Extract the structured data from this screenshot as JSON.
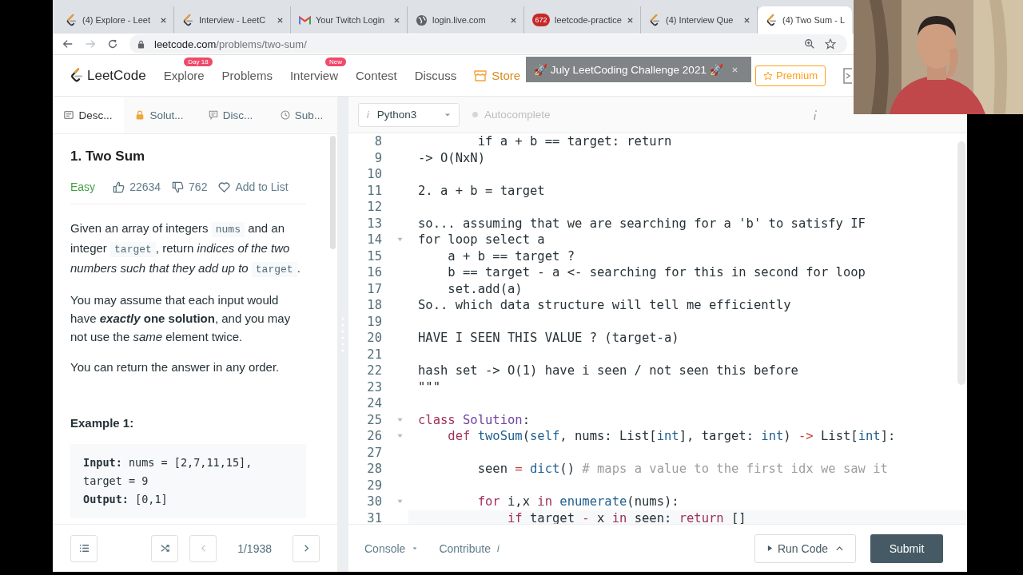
{
  "browser": {
    "tabs": [
      {
        "title": "(4) Explore - Leet",
        "kind": "leetcode",
        "selected": false
      },
      {
        "title": "Interview - LeetC",
        "kind": "leetcode",
        "selected": false
      },
      {
        "title": "Your Twitch Login",
        "kind": "mail",
        "selected": false
      },
      {
        "title": "login.live.com",
        "kind": "globe",
        "selected": false
      },
      {
        "title": "leetcode-practice",
        "kind": "badge",
        "badge": "672",
        "selected": false
      },
      {
        "title": "(4) Interview Que",
        "kind": "leetcode",
        "selected": false
      },
      {
        "title": "(4) Two Sum - L",
        "kind": "leetcode",
        "selected": true
      }
    ],
    "url_host": "leetcode.com",
    "url_path": "/problems/two-sum/"
  },
  "nav": {
    "logo": "LeetCode",
    "items": [
      {
        "label": "Explore",
        "badge": "Day 18",
        "kind": "link"
      },
      {
        "label": "Problems",
        "kind": "link"
      },
      {
        "label": "Interview",
        "badge": "New",
        "kind": "link"
      },
      {
        "label": "Contest",
        "kind": "link"
      },
      {
        "label": "Discuss",
        "kind": "link"
      },
      {
        "label": "Store",
        "kind": "store"
      }
    ],
    "toast": "🚀 July LeetCoding Challenge 2021 🚀",
    "premium": "Premium"
  },
  "problem": {
    "tabs": [
      {
        "label": "Desc...",
        "selected": true
      },
      {
        "label": "Solut...",
        "selected": false
      },
      {
        "label": "Disc...",
        "selected": false
      },
      {
        "label": "Sub...",
        "selected": false
      }
    ],
    "title": "1. Two Sum",
    "difficulty": "Easy",
    "likes": "22634",
    "dislikes": "762",
    "add_to_list": "Add to List",
    "paragraphs": [
      [
        {
          "text": "Given an array of integers ",
          "kind": "text"
        },
        {
          "text": "nums",
          "kind": "code"
        },
        {
          "text": " and an integer ",
          "kind": "text"
        },
        {
          "text": "target",
          "kind": "code"
        },
        {
          "text": ", return ",
          "kind": "text"
        },
        {
          "text": "indices of the two numbers such that they add up to ",
          "kind": "italic"
        },
        {
          "text": "target",
          "kind": "code"
        },
        {
          "text": ".",
          "kind": "text"
        }
      ],
      [
        {
          "text": "You may assume that each input would have ",
          "kind": "text"
        },
        {
          "text": "exactly",
          "kind": "bold-italic"
        },
        {
          "text": " one solution",
          "kind": "bold"
        },
        {
          "text": ", and you may not use the ",
          "kind": "text"
        },
        {
          "text": "same",
          "kind": "italic"
        },
        {
          "text": " element twice.",
          "kind": "text"
        }
      ],
      [
        {
          "text": "You can return the answer in any order.",
          "kind": "text"
        }
      ]
    ],
    "example_title": "Example 1:",
    "example_lines": [
      {
        "label": "Input:",
        "text": " nums = [2,7,11,15],"
      },
      {
        "text": "target = 9"
      },
      {
        "label": "Output:",
        "text": " [0,1]"
      }
    ],
    "pager": "1/1938"
  },
  "editor": {
    "language_info": "i",
    "language": "Python3",
    "autocomplete": {
      "label": "Autocomplete",
      "on": false
    },
    "lines": [
      {
        "no": "8",
        "foldable": false,
        "active": false,
        "tokens": [
          {
            "text": "        if a + b == target: return",
            "kind": "text"
          }
        ]
      },
      {
        "no": "9",
        "foldable": false,
        "active": false,
        "tokens": [
          {
            "text": "-> O(NxN)",
            "kind": "text"
          }
        ]
      },
      {
        "no": "10",
        "foldable": false,
        "active": false
      },
      {
        "no": "11",
        "foldable": false,
        "active": false,
        "tokens": [
          {
            "text": "2. a + b = target",
            "kind": "text"
          }
        ]
      },
      {
        "no": "12",
        "foldable": false,
        "active": false
      },
      {
        "no": "13",
        "foldable": false,
        "active": false,
        "tokens": [
          {
            "text": "so... assuming that we are searching for a 'b' to satisfy IF",
            "kind": "text"
          }
        ]
      },
      {
        "no": "14",
        "foldable": true,
        "active": false,
        "tokens": [
          {
            "text": "for loop select a",
            "kind": "text"
          }
        ]
      },
      {
        "no": "15",
        "foldable": false,
        "active": false,
        "tokens": [
          {
            "text": "    a + b == target ?",
            "kind": "text"
          }
        ]
      },
      {
        "no": "16",
        "foldable": false,
        "active": false,
        "tokens": [
          {
            "text": "    b == target - a <- searching for this in second for loop",
            "kind": "text"
          }
        ]
      },
      {
        "no": "17",
        "foldable": false,
        "active": false,
        "tokens": [
          {
            "text": "    set.add(a)",
            "kind": "text"
          }
        ]
      },
      {
        "no": "18",
        "foldable": false,
        "active": false,
        "tokens": [
          {
            "text": "So.. which data structure will tell me efficiently",
            "kind": "text"
          }
        ]
      },
      {
        "no": "19",
        "foldable": false,
        "active": false
      },
      {
        "no": "20",
        "foldable": false,
        "active": false,
        "tokens": [
          {
            "text": "HAVE I SEEN THIS VALUE ? (target-a)",
            "kind": "text"
          }
        ]
      },
      {
        "no": "21",
        "foldable": false,
        "active": false
      },
      {
        "no": "22",
        "foldable": false,
        "active": false,
        "tokens": [
          {
            "text": "hash set -> O(1) have i seen / not seen this before",
            "kind": "text"
          }
        ]
      },
      {
        "no": "23",
        "foldable": false,
        "active": false,
        "tokens": [
          {
            "text": "\"\"\"",
            "kind": "text"
          }
        ]
      },
      {
        "no": "24",
        "foldable": false,
        "active": false
      },
      {
        "no": "25",
        "foldable": true,
        "active": false,
        "tokens": [
          {
            "text": "class ",
            "kind": "keyword"
          },
          {
            "text": "Solution",
            "kind": "class"
          },
          {
            "text": ":",
            "kind": "plain"
          }
        ]
      },
      {
        "no": "26",
        "foldable": true,
        "active": false,
        "tokens": [
          {
            "text": "    def ",
            "kind": "keyword"
          },
          {
            "text": "twoSum",
            "kind": "builtin"
          },
          {
            "text": "(",
            "kind": "plain"
          },
          {
            "text": "self",
            "kind": "builtin"
          },
          {
            "text": ", nums: List[",
            "kind": "plain"
          },
          {
            "text": "int",
            "kind": "builtin"
          },
          {
            "text": "], target: ",
            "kind": "plain"
          },
          {
            "text": "int",
            "kind": "builtin"
          },
          {
            "text": ") ",
            "kind": "plain"
          },
          {
            "text": "->",
            "kind": "operator"
          },
          {
            "text": " List[",
            "kind": "plain"
          },
          {
            "text": "int",
            "kind": "builtin"
          },
          {
            "text": "]:",
            "kind": "plain"
          }
        ]
      },
      {
        "no": "27",
        "foldable": false,
        "active": false
      },
      {
        "no": "28",
        "foldable": false,
        "active": false,
        "tokens": [
          {
            "text": "        seen ",
            "kind": "plain"
          },
          {
            "text": "= ",
            "kind": "operator"
          },
          {
            "text": "dict",
            "kind": "builtin"
          },
          {
            "text": "() ",
            "kind": "plain"
          },
          {
            "text": "# maps a value to the first idx we saw it",
            "kind": "comment"
          }
        ]
      },
      {
        "no": "29",
        "foldable": false,
        "active": false
      },
      {
        "no": "30",
        "foldable": true,
        "active": false,
        "tokens": [
          {
            "text": "        for",
            "kind": "keyword"
          },
          {
            "text": " i,x ",
            "kind": "plain"
          },
          {
            "text": "in ",
            "kind": "keyword"
          },
          {
            "text": "enumerate",
            "kind": "builtin"
          },
          {
            "text": "(nums):",
            "kind": "plain"
          }
        ]
      },
      {
        "no": "31",
        "foldable": false,
        "active": true,
        "tokens": [
          {
            "text": "            if",
            "kind": "keyword"
          },
          {
            "text": " target ",
            "kind": "plain"
          },
          {
            "text": "-",
            "kind": "operator"
          },
          {
            "text": " x ",
            "kind": "plain"
          },
          {
            "text": "in",
            "kind": "keyword"
          },
          {
            "text": " seen: ",
            "kind": "plain"
          },
          {
            "text": "return",
            "kind": "keyword"
          },
          {
            "text": " []",
            "kind": "plain"
          }
        ]
      }
    ],
    "console": "Console",
    "contribute": "Contribute",
    "contribute_info": "i",
    "run": "Run Code",
    "submit": "Submit"
  }
}
